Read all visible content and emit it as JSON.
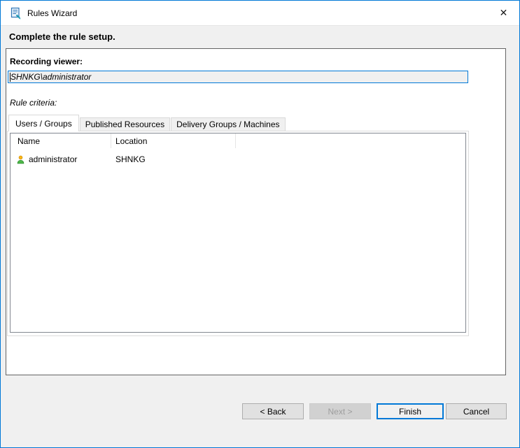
{
  "window": {
    "title": "Rules Wizard"
  },
  "icons": {
    "close": "✕"
  },
  "header": {
    "title": "Complete the rule setup."
  },
  "form": {
    "recording_viewer_label": "Recording viewer:",
    "recording_viewer_value": "SHNKG\\administrator",
    "rule_criteria_label": "Rule criteria:"
  },
  "tabs": [
    {
      "label": "Users / Groups",
      "selected": true
    },
    {
      "label": "Published Resources",
      "selected": false
    },
    {
      "label": "Delivery Groups / Machines",
      "selected": false
    }
  ],
  "user_table": {
    "columns": [
      {
        "label": "Name"
      },
      {
        "label": "Location"
      }
    ],
    "rows": [
      {
        "icon": "user-icon",
        "name": "administrator",
        "location": "SHNKG"
      }
    ]
  },
  "footer": {
    "back_label": "< Back",
    "next_label": "Next >",
    "finish_label": "Finish",
    "cancel_label": "Cancel"
  },
  "colors": {
    "accent_blue": "#0078d7",
    "window_bg": "#f0f0f0",
    "titlebar_bg": "#ffffff",
    "panel_border": "#646464",
    "list_border": "#828790",
    "button_bg": "#e1e1e1",
    "button_border": "#adadad",
    "disabled_button_bg": "#d1d1d1",
    "disabled_button_text": "#9e9e9e",
    "user_icon_body_green": "#4db848",
    "user_icon_head_gold": "#fdb813"
  }
}
